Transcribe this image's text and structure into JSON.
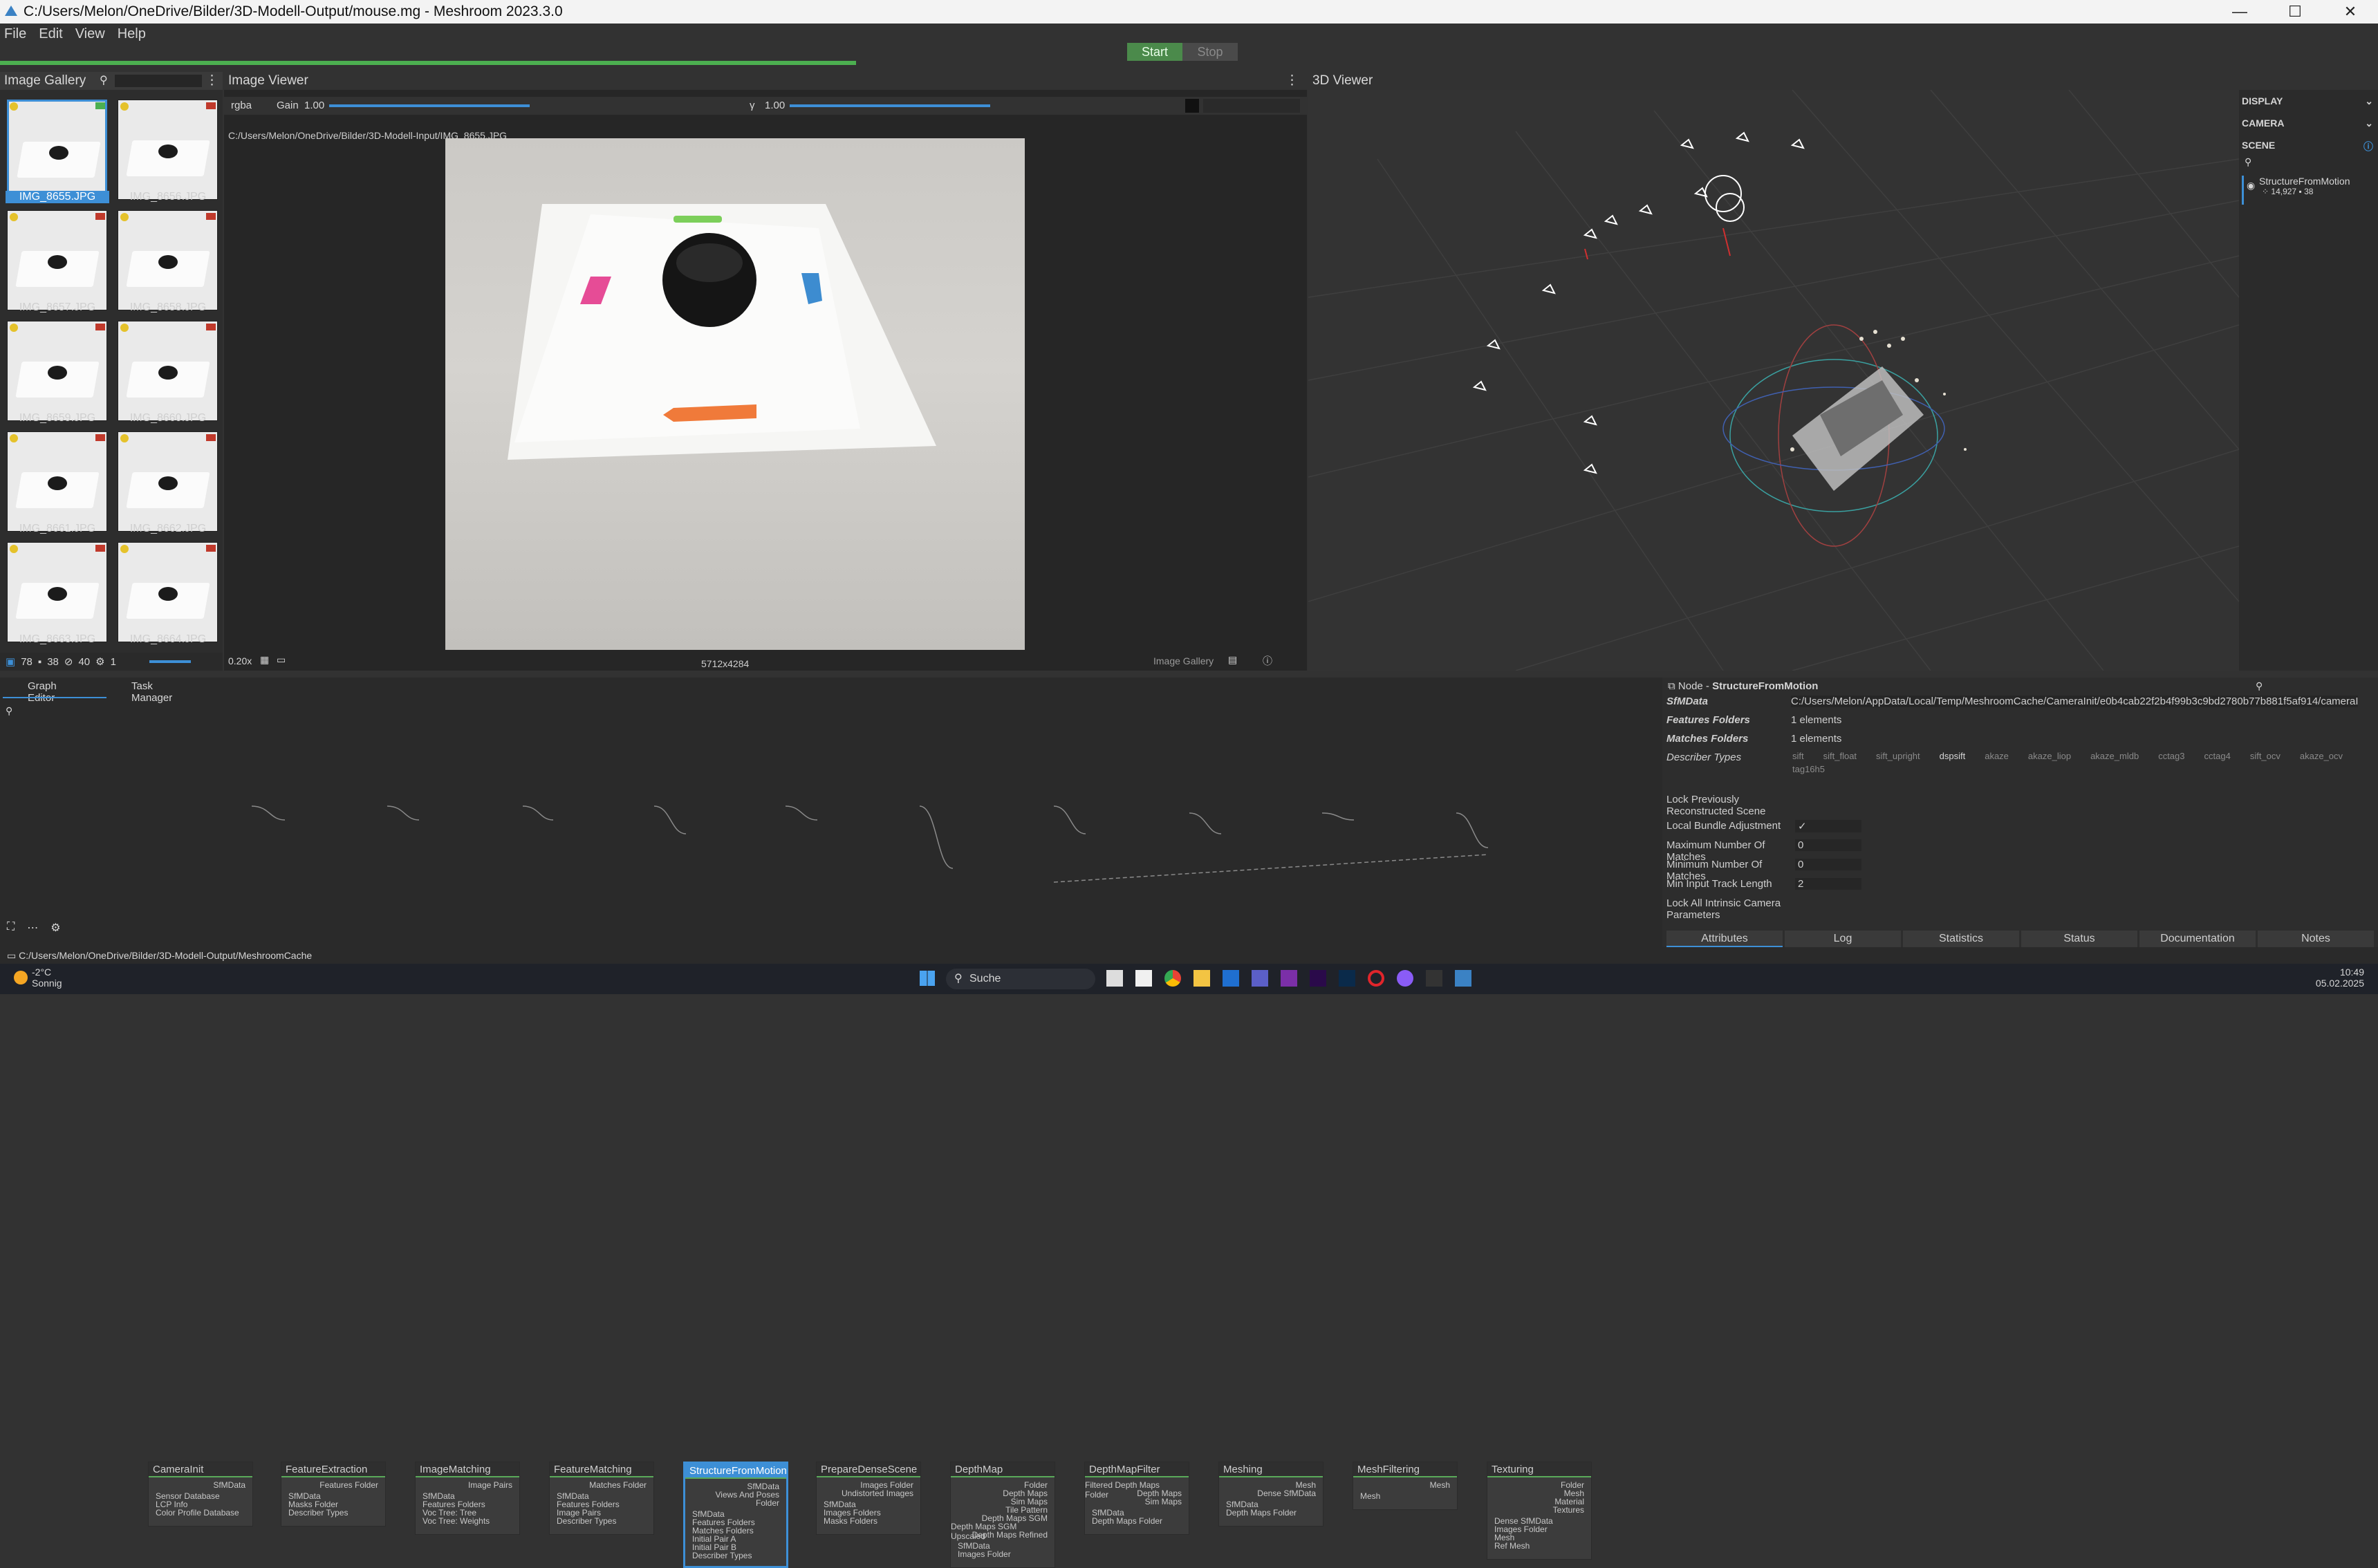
{
  "window": {
    "title": "C:/Users/Melon/OneDrive/Bilder/3D-Modell-Output/mouse.mg - Meshroom 2023.3.0",
    "minimize": "—",
    "maximize": "☐",
    "close": "✕"
  },
  "menu": [
    "File",
    "Edit",
    "View",
    "Help"
  ],
  "toolbar": {
    "start": "Start",
    "stop": "Stop",
    "progress": 0.36
  },
  "gallery": {
    "title": "Image Gallery",
    "images": [
      "IMG_8655.JPG",
      "IMG_8656.JPG",
      "IMG_8657.JPG",
      "IMG_8658.JPG",
      "IMG_8659.JPG",
      "IMG_8660.JPG",
      "IMG_8661.JPG",
      "IMG_8662.JPG",
      "IMG_8663.JPG",
      "IMG_8664.JPG"
    ],
    "footer": {
      "count1": "78",
      "count2": "38",
      "count3": "40",
      "count4": "1"
    }
  },
  "viewer": {
    "title": "Image Viewer",
    "channel": "rgba",
    "gain_label": "Gain",
    "gain_value": "1.00",
    "gamma_label": "γ",
    "gamma_value": "1.00",
    "path": "C:/Users/Melon/OneDrive/Bilder/3D-Modell-Input/IMG_8655.JPG",
    "resolution": "5712x4284",
    "zoom": "0.20x",
    "source": "Image Gallery"
  },
  "viewer3d": {
    "title": "3D Viewer",
    "sections": [
      "DISPLAY",
      "CAMERA",
      "SCENE"
    ],
    "scene_item": "StructureFromMotion",
    "scene_points": "14,927",
    "scene_cams": "38"
  },
  "grapheditor": {
    "tabs": [
      "Graph Editor",
      "Task Manager"
    ],
    "nodes": [
      {
        "name": "CameraInit",
        "outputs": [
          "SfMData"
        ],
        "inputs": [
          "Sensor Database",
          "LCP Info",
          "Color Profile Database"
        ]
      },
      {
        "name": "FeatureExtraction",
        "outputs": [
          "Features Folder"
        ],
        "inputs": [
          "SfMData",
          "Masks Folder",
          "Describer Types"
        ]
      },
      {
        "name": "ImageMatching",
        "outputs": [
          "Image Pairs"
        ],
        "inputs": [
          "SfMData",
          "Features Folders",
          "Voc Tree: Tree",
          "Voc Tree: Weights"
        ]
      },
      {
        "name": "FeatureMatching",
        "outputs": [
          "Matches Folder"
        ],
        "inputs": [
          "SfMData",
          "Features Folders",
          "Image Pairs",
          "Describer Types"
        ]
      },
      {
        "name": "StructureFromMotion",
        "outputs": [
          "SfMData",
          "Views And Poses",
          "Folder"
        ],
        "inputs": [
          "SfMData",
          "Features Folders",
          "Matches Folders",
          "Initial Pair A",
          "Initial Pair B",
          "Describer Types"
        ]
      },
      {
        "name": "PrepareDenseScene",
        "outputs": [
          "Images Folder",
          "Undistorted Images"
        ],
        "inputs": [
          "SfMData",
          "Images Folders",
          "Masks Folders"
        ]
      },
      {
        "name": "DepthMap",
        "outputs": [
          "Folder",
          "Depth Maps",
          "Sim Maps",
          "Tile Pattern",
          "Depth Maps SGM",
          "Depth Maps SGM Upscaled",
          "Depth Maps Refined"
        ],
        "inputs": [
          "SfMData",
          "Images Folder"
        ]
      },
      {
        "name": "DepthMapFilter",
        "outputs": [
          "Filtered Depth Maps Folder",
          "Depth Maps",
          "Sim Maps"
        ],
        "inputs": [
          "SfMData",
          "Depth Maps Folder"
        ]
      },
      {
        "name": "Meshing",
        "outputs": [
          "Mesh",
          "Dense SfMData"
        ],
        "inputs": [
          "SfMData",
          "Depth Maps Folder"
        ]
      },
      {
        "name": "MeshFiltering",
        "outputs": [
          "Mesh"
        ],
        "inputs": [
          "Mesh"
        ]
      },
      {
        "name": "Texturing",
        "outputs": [
          "Folder",
          "Mesh",
          "Material",
          "Textures"
        ],
        "inputs": [
          "Dense SfMData",
          "Images Folder",
          "Mesh",
          "Ref Mesh"
        ]
      }
    ],
    "cache_path": "C:/Users/Melon/OneDrive/Bilder/3D-Modell-Output/MeshroomCache"
  },
  "attributes": {
    "header_prefix": "Node",
    "node_name": "StructureFromMotion",
    "rows": [
      {
        "label": "SfMData",
        "value": "C:/Users/Melon/AppData/Local/Temp/MeshroomCache/CameraInit/e0b4cab22f2b4f99b3c9bd2780b77b881f5af914/cameraInit.sfm"
      },
      {
        "label": "Features Folders",
        "value": "1 elements"
      },
      {
        "label": "Matches Folders",
        "value": "1 elements"
      },
      {
        "label": "Describer Types",
        "value": ""
      }
    ],
    "describer_types": [
      "sift",
      "sift_float",
      "sift_upright",
      "dspsift",
      "akaze",
      "akaze_liop",
      "akaze_mldb",
      "cctag3",
      "cctag4",
      "sift_ocv",
      "akaze_ocv",
      "tag16h5"
    ],
    "describer_checked": "dspsift",
    "options": [
      {
        "label": "Lock Previously Reconstructed Scene",
        "value": ""
      },
      {
        "label": "Local Bundle Adjustment",
        "value": "✓"
      },
      {
        "label": "Maximum Number Of Matches",
        "value": "0"
      },
      {
        "label": "Minimum Number Of Matches",
        "value": "0"
      },
      {
        "label": "Min Input Track Length",
        "value": "2"
      },
      {
        "label": "Lock All Intrinsic Camera Parameters",
        "value": ""
      }
    ],
    "bottom_tabs": [
      "Attributes",
      "Log",
      "Statistics",
      "Status",
      "Documentation",
      "Notes"
    ]
  },
  "taskbar": {
    "temperature": "-2°C",
    "weather": "Sonnig",
    "search": "Suche",
    "time": "10:49",
    "date": "05.02.2025"
  }
}
